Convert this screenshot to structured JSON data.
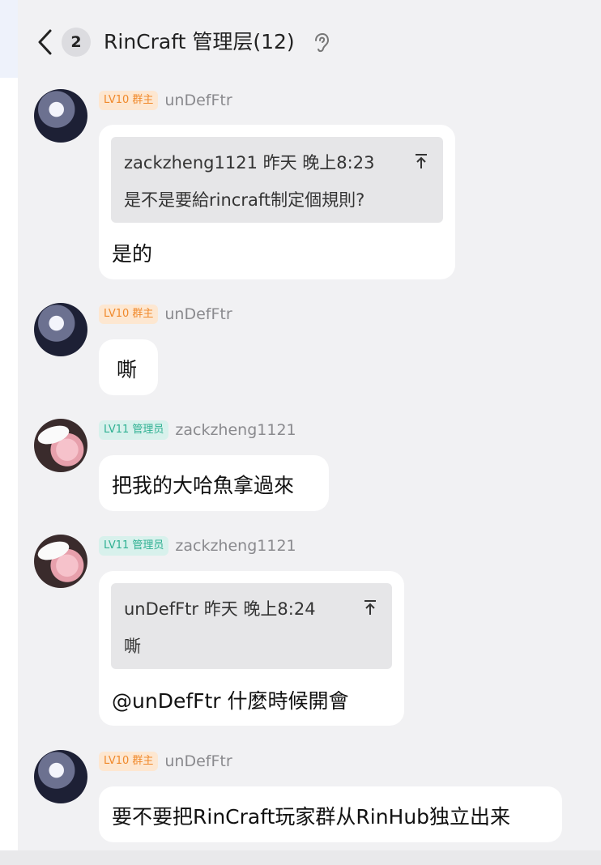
{
  "header": {
    "unread_count": "2",
    "title": "RinCraft 管理层(12)"
  },
  "messages": [
    {
      "level_tag": "LV10 群主",
      "sender": "unDefFtr",
      "quote": {
        "author": "zackzheng1121",
        "time": "昨天 晚上8:23",
        "text": "是不是要給rincraft制定個規則?"
      },
      "text": "是的"
    },
    {
      "level_tag": "LV10 群主",
      "sender": "unDefFtr",
      "text": "嘶"
    },
    {
      "level_tag": "LV11 管理员",
      "sender": "zackzheng1121",
      "text": "把我的大哈魚拿過來"
    },
    {
      "level_tag": "LV11 管理员",
      "sender": "zackzheng1121",
      "quote": {
        "author": "unDefFtr",
        "time": "昨天 晚上8:24",
        "text": "嘶"
      },
      "text": "@unDefFtr 什麼時候開會"
    },
    {
      "level_tag": "LV10 群主",
      "sender": "unDefFtr",
      "text": "要不要把RinCraft玩家群从RinHub独立出来"
    }
  ],
  "colors": {
    "owner_tag_bg": "#fde7d1",
    "owner_tag_text": "#f0892b",
    "admin_tag_bg": "#d8f1ec",
    "admin_tag_text": "#2fb092"
  }
}
